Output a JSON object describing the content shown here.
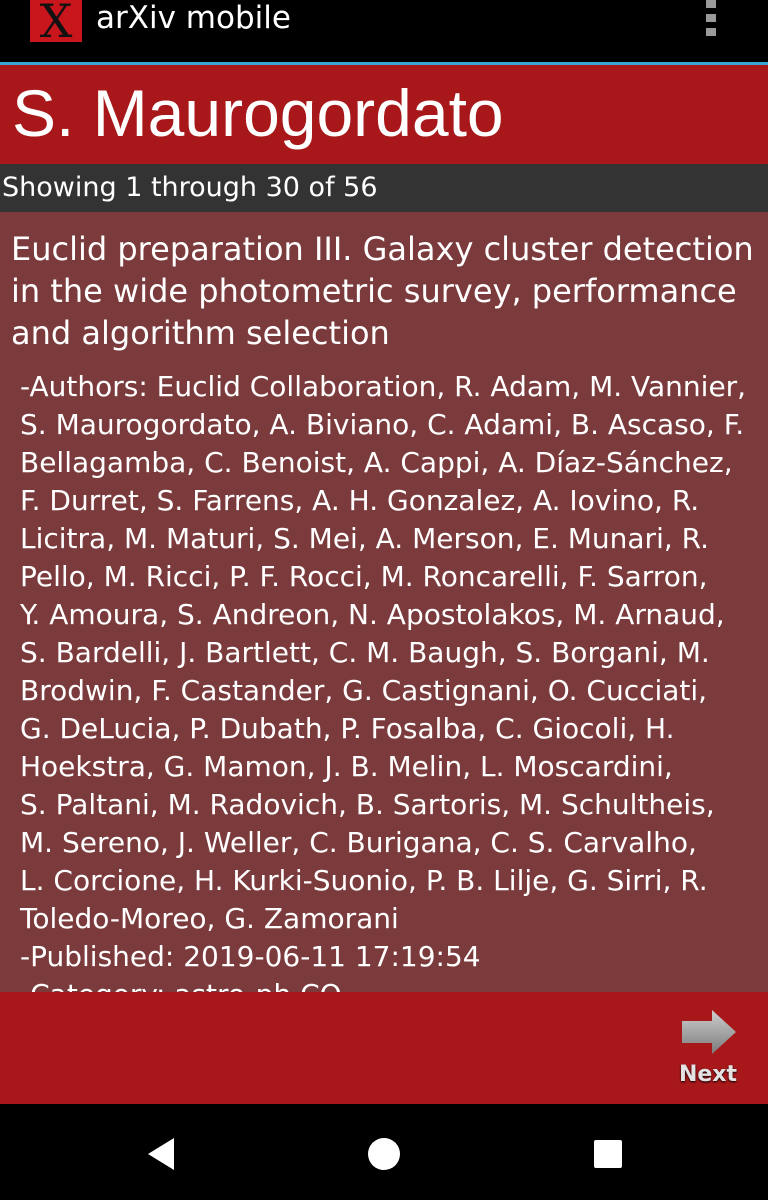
{
  "app": {
    "logo_letter": "X",
    "title": "arXiv mobile",
    "menu_icon": "overflow-menu-icon"
  },
  "header": {
    "title": "S. Maurogordato"
  },
  "results": {
    "showing": "Showing 1 through 30 of 56"
  },
  "paper": {
    "title": "Euclid preparation III. Galaxy cluster detection in the wide photometric survey, performance and algorithm selection",
    "author_lines": [
      "-Authors:  Euclid Collaboration, R. Adam, M. Vannier,",
      "S. Maurogordato, A. Biviano, C. Adami, B. Ascaso, F.",
      "Bellagamba, C. Benoist, A. Cappi, A. Díaz-Sánchez,",
      "F. Durret, S. Farrens, A. H. Gonzalez, A. Iovino, R.",
      "Licitra, M. Maturi, S. Mei, A. Merson, E. Munari, R.",
      "Pello, M. Ricci, P. F. Rocci, M. Roncarelli, F. Sarron,",
      "Y. Amoura, S. Andreon, N. Apostolakos, M. Arnaud,",
      "S. Bardelli, J. Bartlett, C. M. Baugh, S. Borgani, M.",
      "Brodwin, F. Castander, G. Castignani, O. Cucciati,",
      "G. DeLucia, P. Dubath, P. Fosalba, C. Giocoli, H.",
      "Hoekstra, G. Mamon, J. B. Melin, L. Moscardini,",
      "S. Paltani, M. Radovich, B. Sartoris, M. Schultheis,",
      "M. Sereno, J. Weller, C. Burigana, C. S. Carvalho,",
      "L. Corcione, H. Kurki-Suonio, P. B. Lilje, G. Sirri, R.",
      "Toledo-Moreo, G. Zamorani"
    ],
    "published": "-Published: 2019-06-11 17:19:54",
    "category": "-Category: astro-ph.CO"
  },
  "footer": {
    "next_label": "Next",
    "next_icon": "arrow-right-icon"
  },
  "system_nav": {
    "back_icon": "back-triangle-icon",
    "home_icon": "home-circle-icon",
    "recents_icon": "recents-square-icon"
  },
  "colors": {
    "header_red": "#a8181b",
    "content_bg": "#7b3a3c",
    "count_bar": "#333333",
    "accent_line": "#3aa7d6"
  }
}
